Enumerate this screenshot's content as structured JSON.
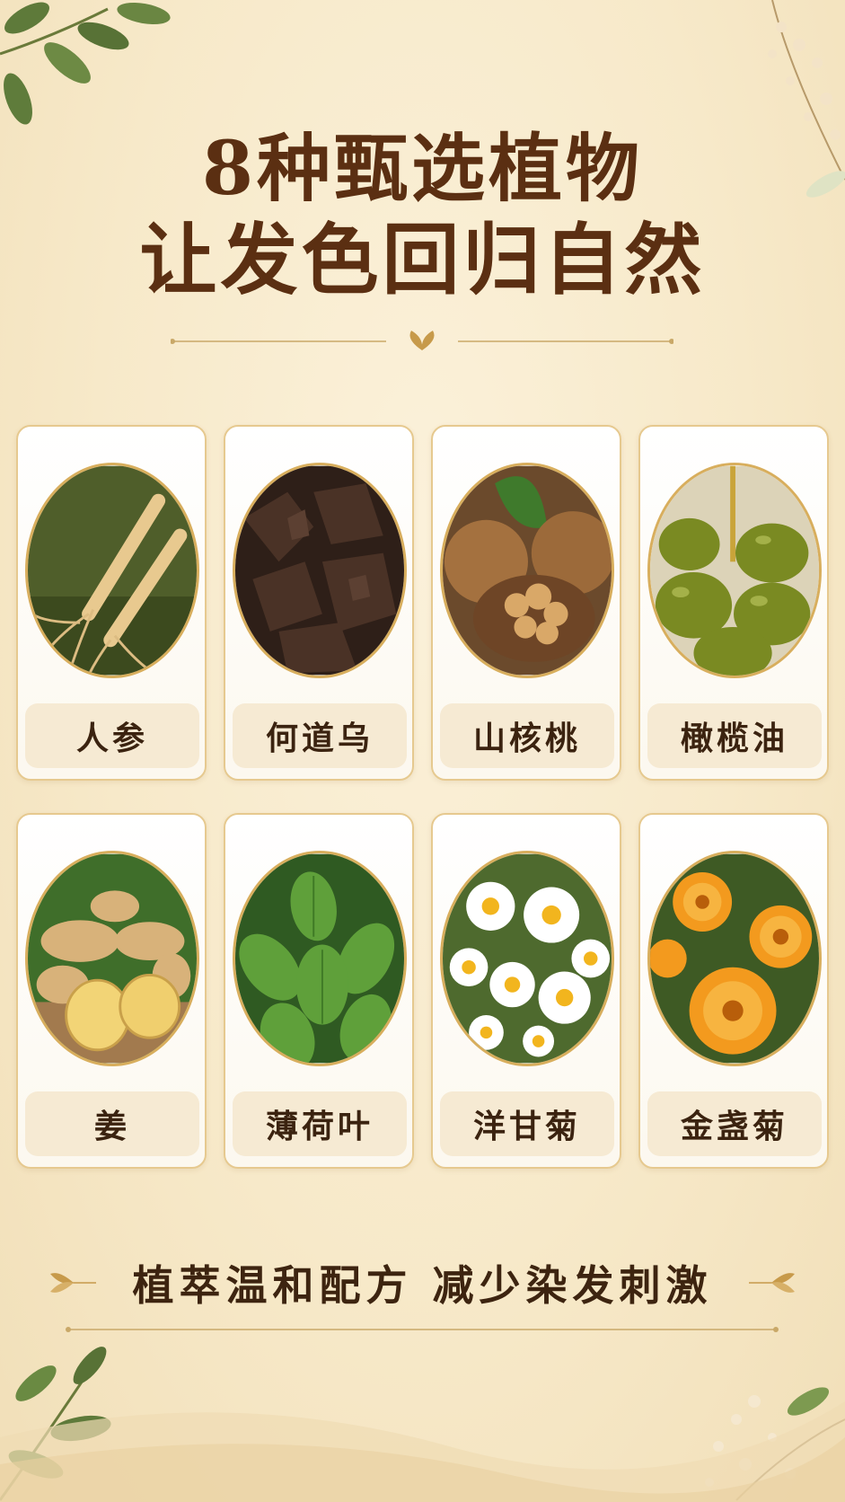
{
  "header": {
    "title_line1": "8种甄选植物",
    "title_line2": "让发色回归自然"
  },
  "plants": [
    {
      "label": "人参",
      "icon": "ginseng-root"
    },
    {
      "label": "何道乌",
      "icon": "heshouwu-chunks"
    },
    {
      "label": "山核桃",
      "icon": "walnut"
    },
    {
      "label": "橄榄油",
      "icon": "olive-oil"
    },
    {
      "label": "姜",
      "icon": "ginger"
    },
    {
      "label": "薄荷叶",
      "icon": "mint-leaf"
    },
    {
      "label": "洋甘菊",
      "icon": "chamomile-flower"
    },
    {
      "label": "金盏菊",
      "icon": "calendula-flower"
    }
  ],
  "footer": {
    "slogan": "植萃温和配方 减少染发刺激"
  },
  "colors": {
    "background": "#f7e9c9",
    "title": "#5b2f12",
    "card_border": "#e6c98f",
    "accent_gold": "#d8ae5d"
  }
}
